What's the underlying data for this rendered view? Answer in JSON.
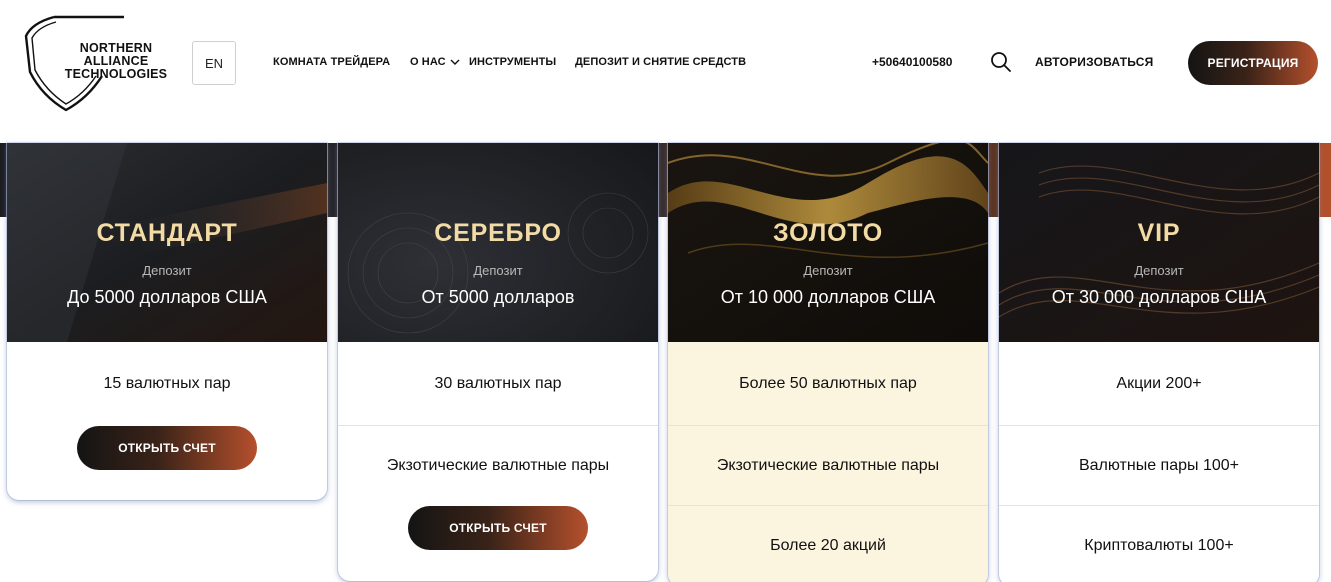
{
  "header": {
    "logo_text": "NORTHERN ALLIANCE TECHNOLOGIES",
    "lang": "EN",
    "nav": [
      "КОМНАТА ТРЕЙДЕРА",
      "О НАС",
      "ИНСТРУМЕНТЫ",
      "ДЕПОЗИТ И СНЯТИЕ СРЕДСТВ"
    ],
    "phone": "+50640100580",
    "login": "АВТОРИЗОВАТЬСЯ",
    "register": "РЕГИСТРАЦИЯ"
  },
  "cards": [
    {
      "title": "СТАНДАРТ",
      "deposit_label": "Депозит",
      "amount": "До 5000 долларов США",
      "features": [
        "15 валютных пар"
      ],
      "button": "ОТКРЫТЬ СЧЕТ"
    },
    {
      "title": "СЕРЕБРО",
      "deposit_label": "Депозит",
      "amount": "От 5000 долларов",
      "features": [
        "30 валютных пар",
        "Экзотические валютные пары"
      ],
      "button": "ОТКРЫТЬ СЧЕТ"
    },
    {
      "title": "ЗОЛОТО",
      "deposit_label": "Депозит",
      "amount": "От 10 000 долларов США",
      "features": [
        "Более 50 валютных пар",
        "Экзотические валютные пары",
        "Более 20 акций"
      ]
    },
    {
      "title": "VIP",
      "deposit_label": "Депозит",
      "amount": "От 30 000 долларов США",
      "features": [
        "Акции 200+",
        "Валютные пары 100+",
        "Криптовалюты 100+"
      ]
    }
  ],
  "colors": {
    "accent_start": "#141414",
    "accent_end": "#b5502c",
    "title_gold": "#f3dba6",
    "gold_feature_bg": "#fbf4df"
  }
}
